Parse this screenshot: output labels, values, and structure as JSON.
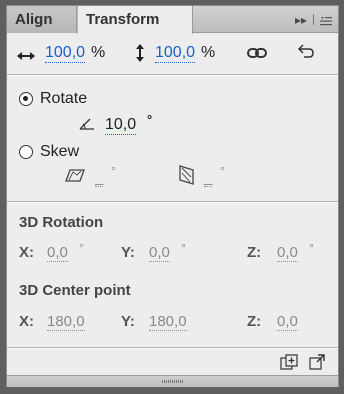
{
  "tabs": [
    {
      "label": "Align"
    },
    {
      "label": "Transform"
    }
  ],
  "scale": {
    "width_value": "100,0",
    "width_unit": "%",
    "height_value": "100,0",
    "height_unit": "%"
  },
  "rotate": {
    "label": "Rotate",
    "value": "10,0",
    "unit": "°",
    "selected": true
  },
  "skew": {
    "label": "Skew",
    "h_value": "_",
    "h_unit": "°",
    "v_value": "_",
    "v_unit": "°",
    "selected": false
  },
  "rotation3d": {
    "title": "3D Rotation",
    "x_label": "X:",
    "x_value": "0,0",
    "x_unit": "°",
    "y_label": "Y:",
    "y_value": "0,0",
    "y_unit": "°",
    "z_label": "Z:",
    "z_value": "0,0",
    "z_unit": "°"
  },
  "center3d": {
    "title": "3D Center point",
    "x_label": "X:",
    "x_value": "180,0",
    "y_label": "Y:",
    "y_value": "180,0",
    "z_label": "Z:",
    "z_value": "0,0"
  },
  "colors": {
    "link": "#1b62c6",
    "disabled": "#8a8a8a",
    "panel": "#ededed"
  }
}
